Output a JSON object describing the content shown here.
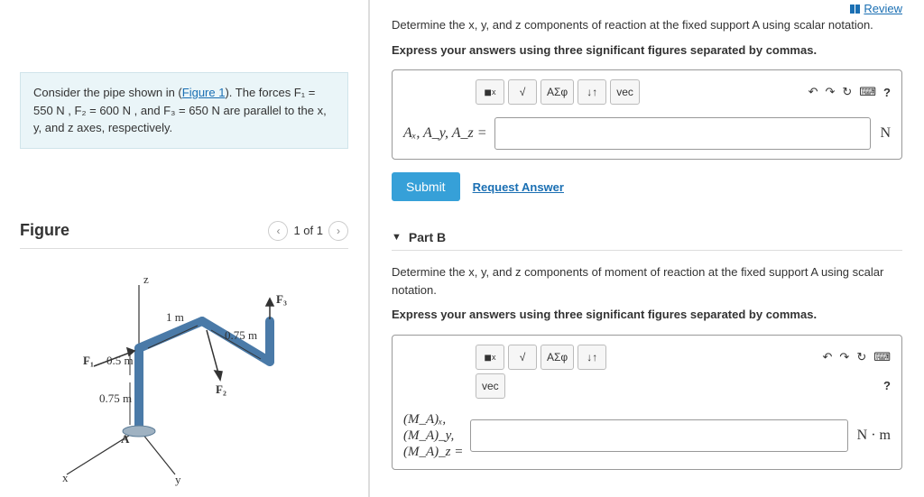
{
  "review_link": "Review",
  "problem": {
    "text_pre": "Consider the pipe shown in (",
    "figure_link": "Figure 1",
    "text_post": "). The forces F₁ = 550 N , F₂ = 600 N , and F₃ = 650 N are parallel to the x, y, and z axes, respectively."
  },
  "figure": {
    "title": "Figure",
    "nav_label": "1 of 1",
    "labels": {
      "axis_z": "z",
      "axis_x": "x",
      "axis_y": "y",
      "pointA": "A",
      "F1": "F₁",
      "F2": "F₂",
      "F3": "F₃",
      "d1": "1 m",
      "d2": "0.5 m",
      "d3": "0.75 m",
      "d4": "0.75 m"
    }
  },
  "partA": {
    "prompt": "Determine the x, y, and z components of reaction at the fixed support A using scalar notation.",
    "instruction": "Express your answers using three significant figures separated by commas.",
    "answer_label": "Aₓ, A_y, A_z =",
    "unit": "N",
    "submit": "Submit",
    "request": "Request Answer",
    "tools": {
      "templates": "■",
      "sqrt": "√",
      "greek": "ΑΣφ",
      "updown": "↓↑",
      "vec": "vec",
      "undo": "↶",
      "redo": "↷",
      "reset": "↻",
      "keyboard": "⌨",
      "help": "?"
    }
  },
  "partB": {
    "header": "Part B",
    "prompt": "Determine the x, y, and z components of moment of reaction at the fixed support A using scalar notation.",
    "instruction": "Express your answers using three significant figures separated by commas.",
    "answer_label_html": [
      "(M_A)ₓ,",
      "(M_A)_y,",
      "(M_A)_z ="
    ],
    "unit": "N · m",
    "tools": {
      "templates": "■",
      "sqrt": "√",
      "greek": "ΑΣφ",
      "updown": "↓↑",
      "vec": "vec",
      "undo": "↶",
      "redo": "↷",
      "reset": "↻",
      "keyboard": "⌨",
      "help": "?"
    }
  }
}
